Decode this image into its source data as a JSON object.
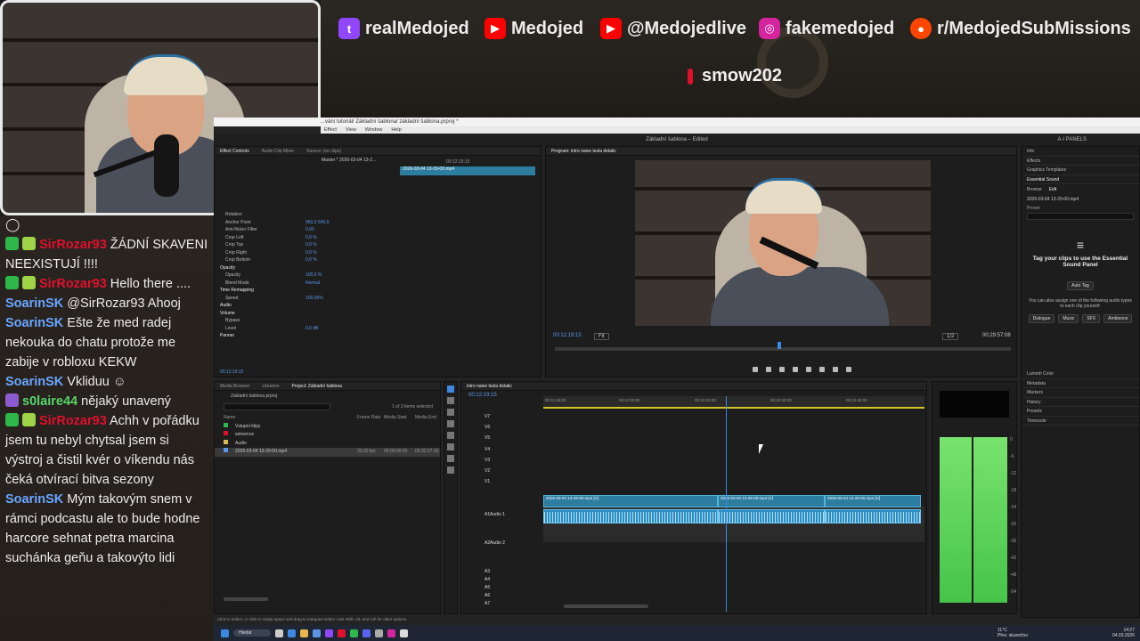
{
  "overlay": {
    "socials": [
      {
        "icon": "twitch-icon",
        "label": "realMedojed",
        "color": "#9146ff",
        "glyph": "t"
      },
      {
        "icon": "youtube-icon",
        "label": "Medojed",
        "color": "#ff0000",
        "glyph": "▶"
      },
      {
        "icon": "youtube-icon",
        "label": "@Medojedlive",
        "color": "#ff0000",
        "glyph": "▶"
      },
      {
        "icon": "instagram-icon",
        "label": "fakemedojed",
        "color": "#d6249f",
        "glyph": "◎"
      },
      {
        "icon": "reddit-icon",
        "label": "r/MedojedSubMissions",
        "color": "#ff4500",
        "glyph": "●"
      }
    ],
    "donor": "smow202"
  },
  "chat": [
    {
      "user": "",
      "text": "",
      "emote": true
    },
    {
      "user": "SirRozar93",
      "cls": "sir",
      "badges": [
        "b-green",
        "b-lime",
        "b-purple"
      ],
      "text": "ŽÁDNÍ SKAVENI NEEXISTUJÍ !!!! "
    },
    {
      "user": "",
      "text": ""
    },
    {
      "user": "SirRozar93",
      "cls": "sir",
      "badges": [
        "b-green",
        "b-lime",
        "b-purple"
      ],
      "text": "Hello there ...."
    },
    {
      "user": "SoarinSK",
      "cls": "soarin",
      "badges": [],
      "text": "@SirRozar93 Ahooj"
    },
    {
      "user": "SoarinSK",
      "cls": "soarin",
      "badges": [],
      "text": "Ešte že med radej nekouka do chatu protože me zabije v robloxu KEKW"
    },
    {
      "user": "SoarinSK",
      "cls": "soarin",
      "badges": [],
      "text": "Vkliduu"
    },
    {
      "user": "s0laire44",
      "cls": "s0l",
      "badges": [
        "b-purple"
      ],
      "text": "nějaký unavený"
    },
    {
      "user": "SirRozar93",
      "cls": "sir",
      "badges": [
        "b-green",
        "b-lime",
        "b-purple"
      ],
      "text": "Achh v pořádku jsem tu nebyl chytsal jsem si výstroj a čistil kvér o víkendu nás čeká otvírací bitva sezony"
    },
    {
      "user": "SoarinSK",
      "cls": "soarin",
      "badges": [],
      "text": "Mým takovým snem v rámci podcastu ale to bude hodne harcore sehnat petra marcina suchánka geňu a takovýto lidi"
    }
  ],
  "premiere": {
    "title": "Základní šablona",
    "title_suffix": "Edited",
    "window_path": "...vání tutoriál/ Základní šablona/ základní šablona.prproj *",
    "menu": [
      "Effect",
      "View",
      "Window",
      "Help"
    ],
    "workspace": "A-I PANELS",
    "source_tabs": [
      "Effect Controls",
      "Audio Clip Mixer",
      "Source: (no clips)"
    ],
    "effect_clip": "Master * 2026-03-04 13-2...",
    "effect_props": [
      {
        "label": "Rotation",
        "value": "",
        "sec": false
      },
      {
        "label": "Anchor Point",
        "value": "960,0    540,0",
        "sec": false
      },
      {
        "label": "Anti-flicker Filter",
        "value": "0,00",
        "sec": false
      },
      {
        "label": "Crop Left",
        "value": "0,0 %",
        "sec": false
      },
      {
        "label": "Crop Top",
        "value": "0,0 %",
        "sec": false
      },
      {
        "label": "Crop Right",
        "value": "0,0 %",
        "sec": false
      },
      {
        "label": "Crop Bottom",
        "value": "0,0 %",
        "sec": false
      },
      {
        "label": "Opacity",
        "value": "",
        "sec": true
      },
      {
        "label": "Opacity",
        "value": "100,0 %",
        "sec": false
      },
      {
        "label": "Blend Mode",
        "value": "Normal",
        "sec": false
      },
      {
        "label": "Time Remapping",
        "value": "",
        "sec": true
      },
      {
        "label": "Speed",
        "value": "100,00%",
        "sec": false
      },
      {
        "label": "Audio",
        "value": "",
        "sec": true
      },
      {
        "label": "Volume",
        "value": "",
        "sec": true
      },
      {
        "label": "Bypass",
        "value": "",
        "sec": false
      },
      {
        "label": "Level",
        "value": "0,0 dB",
        "sec": false
      },
      {
        "label": "Panner",
        "value": "",
        "sec": true
      }
    ],
    "effect_timecode": "00:12:19:15",
    "effect_mini_clip": "2026-03-04 13-29-00.mp4",
    "effect_mini_time": "00:12:19:15",
    "program_tab": "Program: intro naive tesla delatic",
    "program_timecode": "00:12:19:15",
    "program_fit": "Fit",
    "program_scale": "1/2",
    "program_duration": "00:29:57:08",
    "right_tabs": [
      "Info",
      "Effects",
      "Graphics Templates",
      "Essential Sound"
    ],
    "es_browse": "Browse",
    "es_edit": "Edit",
    "es_preset": "Preset",
    "es_clip": "2026-03-04 13-29-00.mp4",
    "es_title": "Tag your clips to use the Essential Sound Panel",
    "es_auto": "Auto Tag",
    "es_hint": "You can also assign one of the following audio types to each clip yourself:",
    "es_types": [
      "Dialogue",
      "Music",
      "SFX",
      "Ambience"
    ],
    "side_list": [
      "Lumetri Color",
      "Metadata",
      "Markers",
      "History",
      "Presets",
      "Timecode"
    ],
    "project_tabs": [
      "Media Browser",
      "Libraries",
      "Project: Základní šablona"
    ],
    "project_file": "Základní šablona.prproj",
    "project_selected": "1 of 3 items selected",
    "project_cols": [
      "Name",
      "Frame Rate",
      "Media Start",
      "Media End"
    ],
    "project_items": [
      {
        "name": "Vstupní klipy",
        "fr": "",
        "ms": "",
        "me": "",
        "color": "#2eb84b"
      },
      {
        "name": "sekvence",
        "fr": "",
        "ms": "",
        "me": "",
        "color": "#e0102c"
      },
      {
        "name": "Audio",
        "fr": "",
        "ms": "",
        "me": "",
        "color": "#d8b850"
      },
      {
        "name": "2026-03-04 13-29-00.mp4",
        "fr": "30,00 fps",
        "ms": "00:00:00:00",
        "me": "00:32:27:26",
        "color": "#5a96e8"
      }
    ],
    "timeline_tab": "intro naive tesla delatic",
    "timeline_timecode": "00:12:19:15",
    "ruler_labels": [
      "00:11:45:00",
      "00:12:00:00",
      "00:12:15:00",
      "00:12:30:00",
      "00:12:45:00"
    ],
    "video_tracks": [
      "V7",
      "V6",
      "V5",
      "V4",
      "V3",
      "V2",
      "V1"
    ],
    "audio_tracks": [
      "A1",
      "A2",
      "A3",
      "A4",
      "A5",
      "A6",
      "A7"
    ],
    "audio1_name": "Audio 1",
    "audio2_name": "Audio 2",
    "clips": [
      "2026-03-04 13-29-00.mp4 [V]",
      "2026-03-04 13-29-00.mp4 [V]",
      "2026-03-04 13-29-00.mp4 [V]"
    ],
    "meter_scale": [
      "0",
      "-6",
      "-12",
      "-18",
      "-24",
      "-30",
      "-36",
      "-42",
      "-48",
      "-54"
    ],
    "status_hint": "Click to select, or click in empty space and drag to marquee select. Use Shift, Alt, and Ctrl for other options."
  },
  "taskbar": {
    "search": "Hledat",
    "weather_temp": "11°C",
    "weather_desc": "Přev. skunečno",
    "time": "14:27",
    "date": "04.03.2026"
  }
}
